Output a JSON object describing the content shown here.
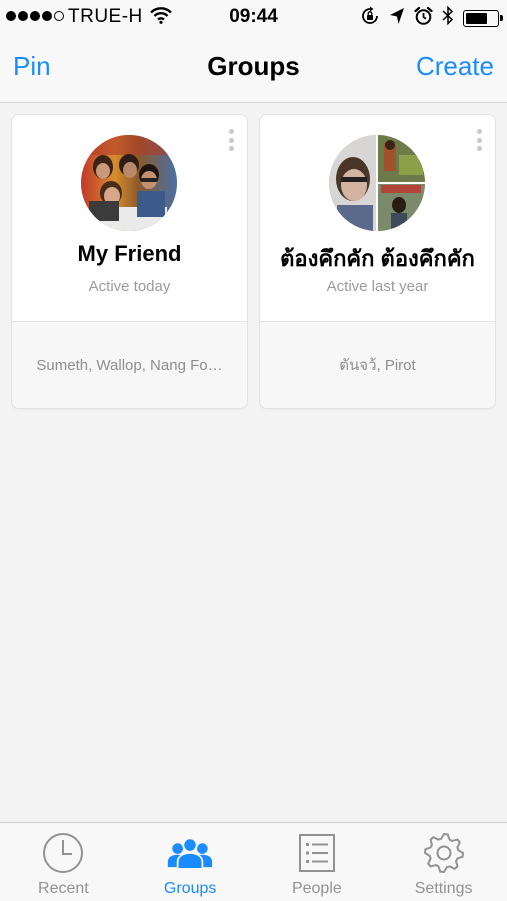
{
  "status_bar": {
    "carrier": "TRUE-H",
    "time": "09:44",
    "signal_bars": 4,
    "signal_total": 5,
    "battery_level": 0.7
  },
  "nav": {
    "left_label": "Pin",
    "title": "Groups",
    "right_label": "Create"
  },
  "groups": [
    {
      "name": "My Friend",
      "status": "Active today",
      "members": "Sumeth, Wallop, Nang Fo…"
    },
    {
      "name": "ต้องคึกคัก ต้องคึกคัก",
      "status": "Active last year",
      "members": "ตันจว้, Pirot"
    }
  ],
  "tabs": [
    {
      "label": "Recent",
      "icon": "clock-icon",
      "active": false
    },
    {
      "label": "Groups",
      "icon": "groups-icon",
      "active": true
    },
    {
      "label": "People",
      "icon": "people-list-icon",
      "active": false
    },
    {
      "label": "Settings",
      "icon": "gear-icon",
      "active": false
    }
  ],
  "colors": {
    "accent": "#1a8cff",
    "inactive": "#929292",
    "background": "#f3f3f3"
  }
}
